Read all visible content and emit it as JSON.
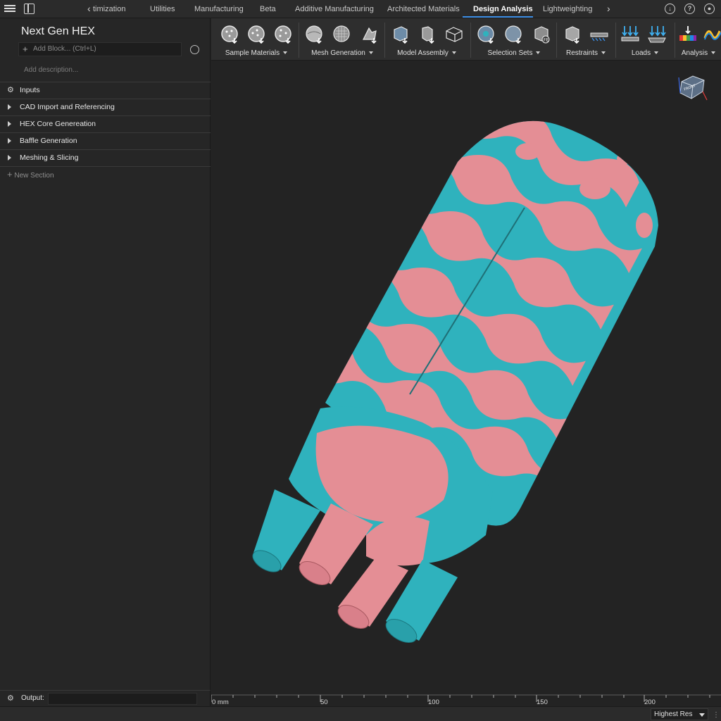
{
  "tabs": {
    "items": [
      "timization",
      "Utilities",
      "Manufacturing",
      "Beta",
      "Additive Manufacturing",
      "Architected Materials",
      "Design Analysis",
      "Lightweighting"
    ],
    "active": "Design Analysis"
  },
  "left_panel": {
    "title": "Next Gen HEX",
    "add_block_placeholder": "Add Block... (Ctrl+L)",
    "description_placeholder": "Add description...",
    "sections": [
      {
        "label": "Inputs"
      },
      {
        "label": "CAD Import and Referencing"
      },
      {
        "label": "HEX Core Genereation"
      },
      {
        "label": "Baffle Generation"
      },
      {
        "label": "Meshing & Slicing"
      }
    ],
    "new_section_label": "New Section",
    "output_label": "Output:"
  },
  "ribbon": {
    "groups": [
      {
        "label": "Sample Materials",
        "icon": "sample-materials-icon"
      },
      {
        "label": "Mesh Generation",
        "icon": "mesh-generation-icon"
      },
      {
        "label": "Model Assembly",
        "icon": "model-assembly-icon"
      },
      {
        "label": "Selection Sets",
        "icon": "selection-sets-icon"
      },
      {
        "label": "Restraints",
        "icon": "restraints-icon"
      },
      {
        "label": "Loads",
        "icon": "loads-icon"
      },
      {
        "label": "Analysis",
        "icon": "analysis-icon"
      }
    ]
  },
  "viewport": {
    "navcube_label": "FRONT",
    "model_colors": {
      "pink": "#e48e95",
      "teal": "#2fb2bd"
    }
  },
  "ruler": {
    "unit_label": "0 mm",
    "ticks": [
      "50",
      "100",
      "150",
      "200"
    ]
  },
  "status": {
    "resolution": "Highest Res"
  }
}
